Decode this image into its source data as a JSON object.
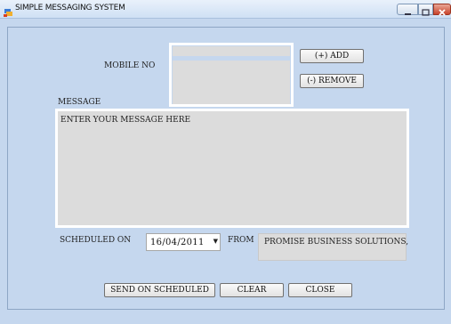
{
  "window": {
    "title": "SIMPLE MESSAGING SYSTEM"
  },
  "form": {
    "mobile_label": "MOBILE NO",
    "add_button": "(+)  ADD",
    "remove_button": "(-) REMOVE",
    "message_label": "MESSAGE",
    "message_placeholder": "ENTER YOUR MESSAGE HERE",
    "scheduled_label": "SCHEDULED ON",
    "scheduled_date": "16/04/2011",
    "from_label": "FROM",
    "from_value": "PROMISE BUSINESS SOLUTIONS,",
    "send_button": "SEND ON SCHEDULED",
    "clear_button": "CLEAR",
    "close_button": "CLOSE"
  }
}
